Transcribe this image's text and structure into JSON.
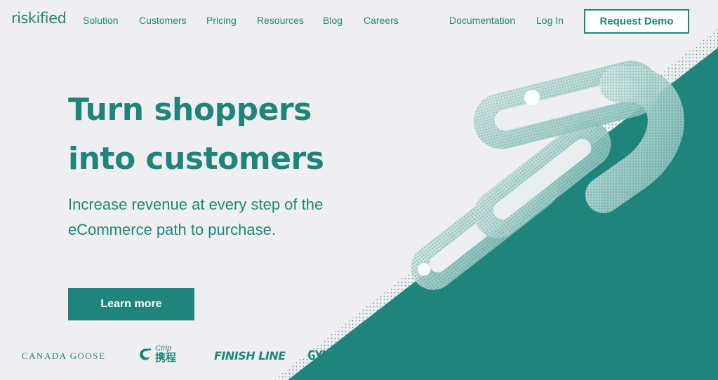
{
  "colors": {
    "brand": "#1f857c",
    "background": "#efeff1",
    "button_text": "#ffffff"
  },
  "nav": {
    "logo": "riskified",
    "links": [
      "Solution",
      "Customers",
      "Pricing",
      "Resources",
      "Blog",
      "Careers"
    ],
    "documentation": "Documentation",
    "login": "Log In",
    "demo": "Request Demo"
  },
  "hero": {
    "headline_line1": "Turn shoppers",
    "headline_line2": "into customers",
    "subhead_line1": "Increase revenue at every step of the",
    "subhead_line2": "eCommerce path to purchase.",
    "cta": "Learn more",
    "art": "chain-links-illustration"
  },
  "logos": {
    "canada_goose": "CANADA GOOSE",
    "ctrip_latin": "Ctrip",
    "ctrip_cjk": "携程",
    "finish_line": "FINISH LINE",
    "gymshark": "GYMSH"
  }
}
